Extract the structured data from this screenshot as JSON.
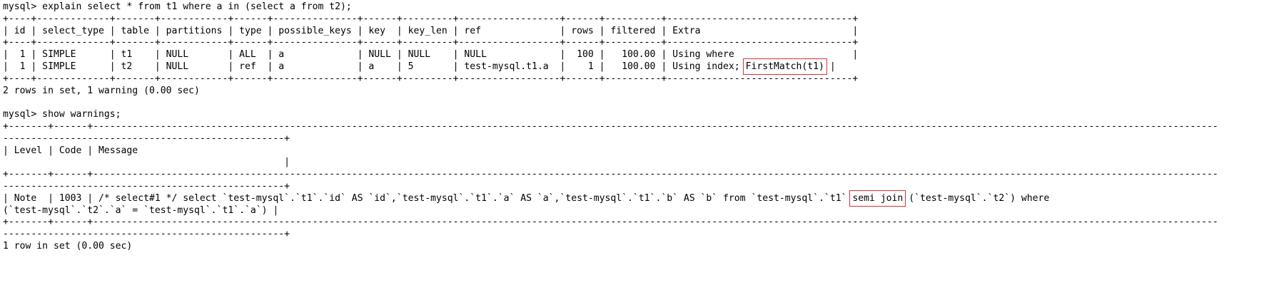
{
  "terminal": {
    "explain_command": "mysql> explain select * from t1 where a in (select a from t2);",
    "explain_border": "+----+-------------+-------+------------+------+---------------+------+---------+------------------+------+----------+---------------------------------+",
    "explain_header": "| id | select_type | table | partitions | type | possible_keys | key  | key_len | ref              | rows | filtered | Extra                           |",
    "explain_rows": [
      {
        "text": "|  1 | SIMPLE      | t1    | NULL       | ALL  | a             | NULL | NULL    | NULL             |  100 |   100.00 | Using where                     |"
      },
      {
        "prefix": "|  1 | SIMPLE      | t2    | NULL       | ref  | a             | a    | 5       | test-mysql.t1.a  |    1 |   100.00 | Using index; ",
        "highlight": "FirstMatch(t1)",
        "suffix": " |"
      }
    ],
    "explain_footer": "2 rows in set, 1 warning (0.00 sec)",
    "warnings_command": "mysql> show warnings;",
    "warn_border_top": "+-------+------+--------------------------------------------------------------------------------------------------------------------------------------------------------------------------------------------------------",
    "warn_border_cont": "--------------------------------------------------+",
    "warn_header": "| Level | Code | Message",
    "warn_header_cont": "                                                  |",
    "warn_row_prefix": "| Note  | 1003 | /* select#1 */ select `test-mysql`.`t1`.`id` AS `id`,`test-mysql`.`t1`.`a` AS `a`,`test-mysql`.`t1`.`b` AS `b` from `test-mysql`.`t1` ",
    "warn_row_highlight": "semi join",
    "warn_row_suffix": " (`test-mysql`.`t2`) where",
    "warn_row_cont": "(`test-mysql`.`t2`.`a` = `test-mysql`.`t1`.`a`) |",
    "warnings_footer": "1 row in set (0.00 sec)"
  },
  "colors": {
    "highlight_box": "#e03030",
    "text": "#000000",
    "background": "#ffffff"
  }
}
